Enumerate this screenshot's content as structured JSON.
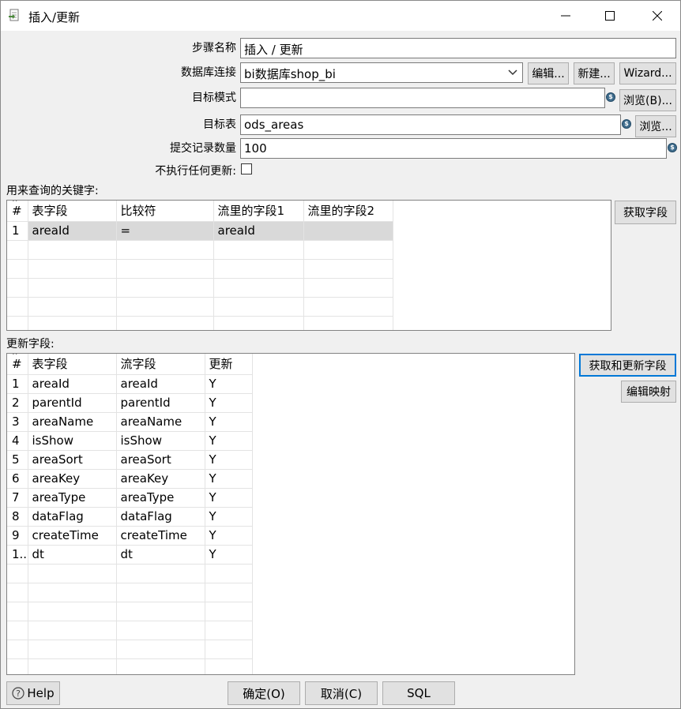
{
  "window": {
    "title": "插入/更新"
  },
  "form": {
    "step_name_label": "步骤名称",
    "step_name_value": "插入 / 更新",
    "db_conn_label": "数据库连接",
    "db_conn_value": "bi数据库shop_bi",
    "edit_label": "编辑...",
    "new_label": "新建...",
    "wizard_label": "Wizard...",
    "schema_label": "目标模式",
    "schema_value": "",
    "browse_b_label": "浏览(B)...",
    "table_label": "目标表",
    "table_value": "ods_areas",
    "browse_label": "浏览...",
    "commit_label": "提交记录数量",
    "commit_value": "100",
    "no_update_label": "不执行任何更新:"
  },
  "keys": {
    "section_label": "用来查询的关键字:",
    "get_fields_label": "获取字段",
    "columns": [
      "#",
      "表字段",
      "比较符",
      "流里的字段1",
      "流里的字段2"
    ],
    "rows": [
      {
        "num": "1",
        "table_field": "areaId",
        "comparator": "=",
        "stream1": "areaId",
        "stream2": ""
      }
    ]
  },
  "updates": {
    "section_label": "更新字段:",
    "get_update_fields_label": "获取和更新字段",
    "edit_mapping_label": "编辑映射",
    "columns": [
      "#",
      "表字段",
      "流字段",
      "更新"
    ],
    "rows": [
      {
        "num": "1",
        "table_field": "areaId",
        "stream_field": "areaId",
        "update": "Y"
      },
      {
        "num": "2",
        "table_field": "parentId",
        "stream_field": "parentId",
        "update": "Y"
      },
      {
        "num": "3",
        "table_field": "areaName",
        "stream_field": "areaName",
        "update": "Y"
      },
      {
        "num": "4",
        "table_field": "isShow",
        "stream_field": "isShow",
        "update": "Y"
      },
      {
        "num": "5",
        "table_field": "areaSort",
        "stream_field": "areaSort",
        "update": "Y"
      },
      {
        "num": "6",
        "table_field": "areaKey",
        "stream_field": "areaKey",
        "update": "Y"
      },
      {
        "num": "7",
        "table_field": "areaType",
        "stream_field": "areaType",
        "update": "Y"
      },
      {
        "num": "8",
        "table_field": "dataFlag",
        "stream_field": "dataFlag",
        "update": "Y"
      },
      {
        "num": "9",
        "table_field": "createTime",
        "stream_field": "createTime",
        "update": "Y"
      },
      {
        "num": "1..",
        "table_field": "dt",
        "stream_field": "dt",
        "update": "Y"
      }
    ]
  },
  "footer": {
    "help_label": "Help",
    "ok_label": "确定(O)",
    "cancel_label": "取消(C)",
    "sql_label": "SQL"
  },
  "colors": {
    "focus_border": "#0078d7",
    "selected_row": "#d9d9d9",
    "variable_icon": "#3f6c8c"
  },
  "icons": [
    "app-icon",
    "minimize-icon",
    "maximize-icon",
    "close-icon",
    "dropdown-arrow-icon",
    "variable-icon",
    "help-icon",
    "sort-caret-icon"
  ]
}
